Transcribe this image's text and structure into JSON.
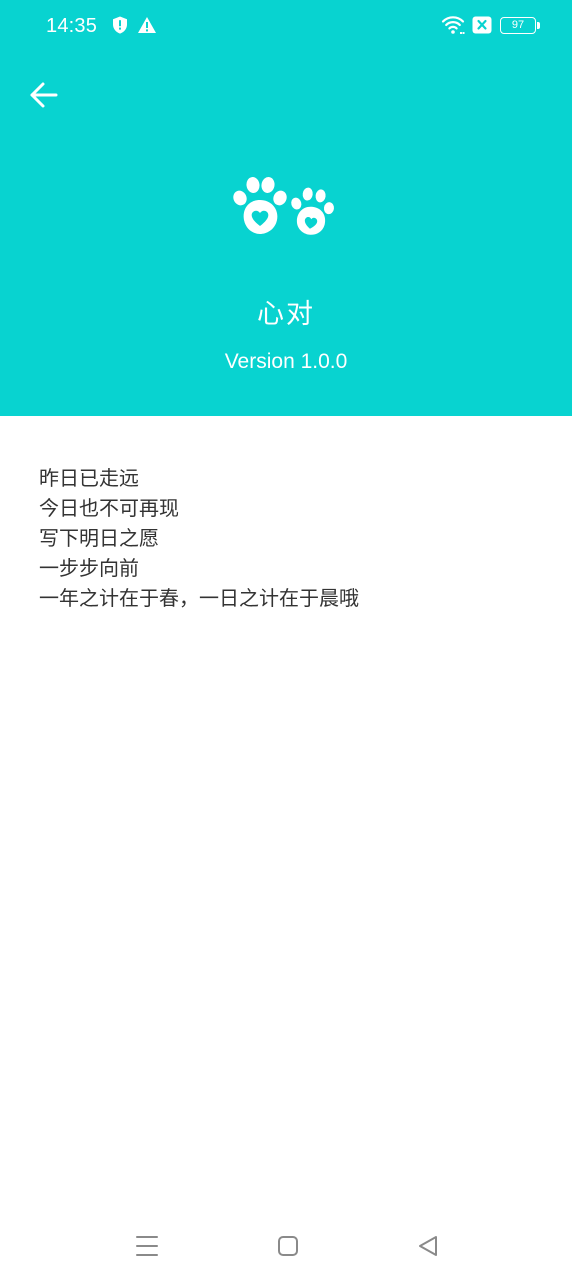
{
  "status_bar": {
    "time": "14:35",
    "left_icons": [
      "shield-icon",
      "warning-icon"
    ],
    "right_icons": [
      "wifi-icon",
      "no-sim-icon",
      "battery-icon"
    ],
    "battery_level": "97"
  },
  "header": {
    "background_color": "#08d3d0",
    "back_icon": "arrow-left-icon",
    "logo_icon": "paw-heart-icon",
    "app_name": "心对",
    "version": "Version 1.0.0"
  },
  "content": {
    "lines": [
      "昨日已走远",
      "今日也不可再现",
      "写下明日之愿",
      "一步步向前",
      "一年之计在于春，一日之计在于晨哦"
    ]
  },
  "nav_bar": {
    "icons": [
      "menu-icon",
      "home-icon",
      "back-triangle-icon"
    ]
  }
}
